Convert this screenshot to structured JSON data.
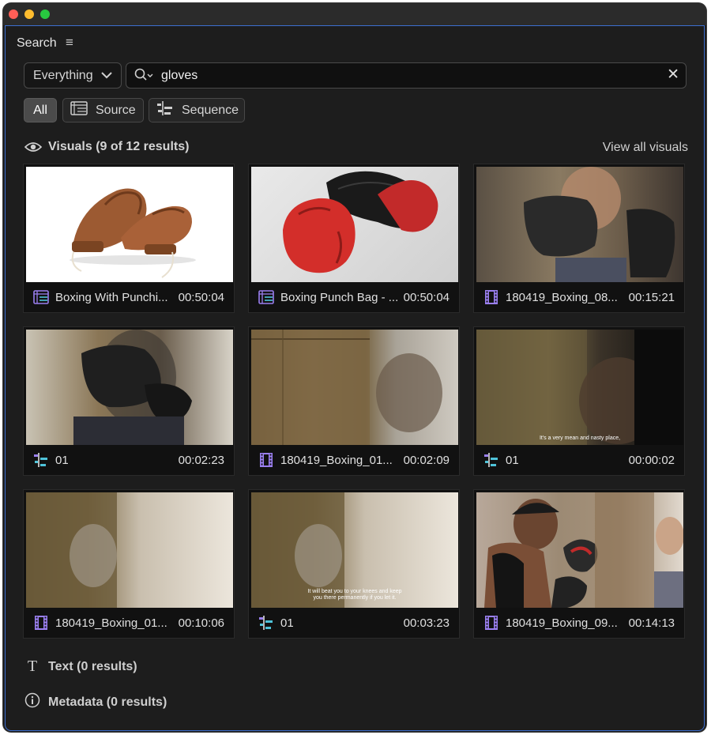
{
  "panel": {
    "title": "Search"
  },
  "scope": {
    "value": "Everything"
  },
  "search": {
    "query": "gloves"
  },
  "filters": [
    {
      "label": "All",
      "active": true
    },
    {
      "label": "Source",
      "active": false
    },
    {
      "label": "Sequence",
      "active": false
    }
  ],
  "visuals": {
    "heading": "Visuals (9 of 12 results)",
    "view_all": "View all visuals"
  },
  "results": [
    {
      "type": "source",
      "name": "Boxing With Punchi...",
      "duration": "00:50:04"
    },
    {
      "type": "source",
      "name": "Boxing Punch Bag - ...",
      "duration": "00:50:04"
    },
    {
      "type": "clip",
      "name": "180419_Boxing_08...",
      "duration": "00:15:21"
    },
    {
      "type": "sequence",
      "name": "01",
      "duration": "00:02:23"
    },
    {
      "type": "clip",
      "name": "180419_Boxing_01...",
      "duration": "00:02:09"
    },
    {
      "type": "sequence",
      "name": "01",
      "duration": "00:00:02",
      "subtitle": "It's a very mean and nasty place,"
    },
    {
      "type": "clip",
      "name": "180419_Boxing_01...",
      "duration": "00:10:06"
    },
    {
      "type": "sequence",
      "name": "01",
      "duration": "00:03:23",
      "subtitle": "It will beat you to your knees and keep you there permanently if you let it."
    },
    {
      "type": "clip",
      "name": "180419_Boxing_09...",
      "duration": "00:14:13"
    }
  ],
  "text_section": {
    "heading": "Text (0 results)"
  },
  "metadata_section": {
    "heading": "Metadata (0 results)"
  },
  "colors": {
    "panel_border": "#3d6fd0",
    "background": "#1d1d1d",
    "clip_icon": "#9a7ff0",
    "sequence_icon": "#4fc3d9"
  }
}
